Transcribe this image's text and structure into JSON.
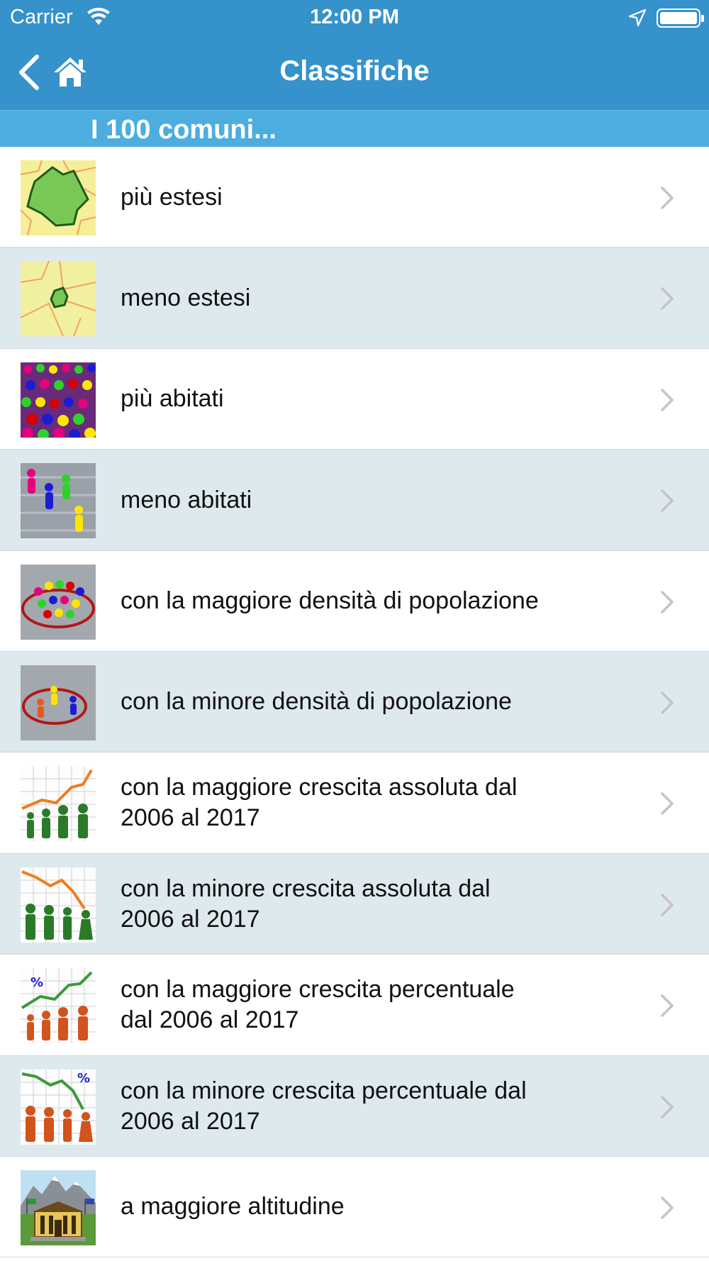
{
  "status_bar": {
    "carrier": "Carrier",
    "time": "12:00 PM",
    "icons": [
      "wifi-icon",
      "location-arrow-icon",
      "battery-icon"
    ]
  },
  "nav": {
    "title": "Classifiche",
    "back_icon": "chevron-left-icon",
    "home_icon": "home-icon",
    "bar_color": "#3592ca"
  },
  "section": {
    "title": "I 100 comuni...",
    "color": "#4daddf"
  },
  "rows": [
    {
      "label": "più estesi",
      "icon": "large-area-map-icon"
    },
    {
      "label": "meno estesi",
      "icon": "small-area-map-icon"
    },
    {
      "label": "più abitati",
      "icon": "crowd-icon"
    },
    {
      "label": "meno abitati",
      "icon": "few-people-icon"
    },
    {
      "label": "con la maggiore densità di popolazione",
      "icon": "dense-crowd-circle-icon"
    },
    {
      "label": "con la minore densità di popolazione",
      "icon": "sparse-crowd-circle-icon"
    },
    {
      "label": "con la maggiore crescita assoluta dal 2006 al 2017",
      "icon": "growth-chart-icon"
    },
    {
      "label": "con la minore crescita assoluta dal 2006 al 2017",
      "icon": "decline-chart-icon"
    },
    {
      "label": "con la maggiore crescita percentuale dal 2006 al 2017",
      "icon": "percent-growth-chart-icon"
    },
    {
      "label": "con la minore crescita percentuale dal 2006 al 2017",
      "icon": "percent-decline-chart-icon"
    },
    {
      "label": "a maggiore altitudine",
      "icon": "mountain-town-hall-icon"
    }
  ],
  "row_colors": {
    "plain": "#ffffff",
    "alt": "#dee9ee"
  }
}
